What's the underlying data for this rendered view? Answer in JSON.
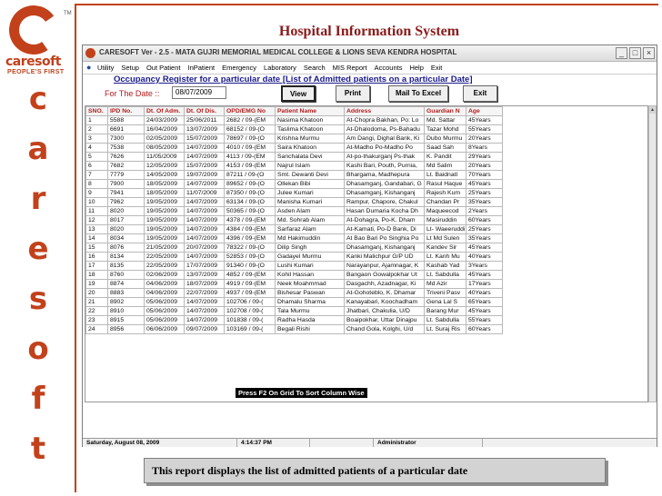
{
  "brand": {
    "logo_name": "caresoft",
    "tagline": "PEOPLE'S FIRST",
    "tm": "TM",
    "vertical_letters": [
      "c",
      "a",
      "r",
      "e",
      "s",
      "o",
      "f",
      "t"
    ],
    "accent": "#c2411b"
  },
  "slide": {
    "title": "Hospital Information System",
    "caption": "This report displays the list of admitted patients of a particular date"
  },
  "window": {
    "title": "CARESOFT  Ver - 2.5 - MATA GUJRI MEMORIAL MEDICAL COLLEGE & LIONS SEVA KENDRA HOSPITAL",
    "min": "_",
    "max": "□",
    "close": "×"
  },
  "menu": [
    "Utility",
    "Setup",
    "Out Patient",
    "InPatient",
    "Emergency",
    "Laboratory",
    "Search",
    "MIS Report",
    "Accounts",
    "Help",
    "Exit"
  ],
  "report": {
    "title": "Occupancy Register for a particular date [List of Admitted patients on a particular Date]",
    "date_label": "For The Date ::",
    "date_value": "08/07/2009",
    "buttons": {
      "view": "View",
      "print": "Print",
      "mail": "Mail To Excel",
      "exit": "Exit"
    }
  },
  "grid": {
    "headers": [
      "SNO.",
      "IPD No.",
      "Dt. Of Adm.",
      "Dt. Of Dis.",
      "OPD/EMG No",
      "Patient Name",
      "Address",
      "Guardian N",
      "Age"
    ],
    "rows": [
      [
        "1",
        "5588",
        "24/03/2009",
        "25/06/2011",
        "2682 / 09-(EM",
        "Nasima Khatoon",
        "At-Chopra Bakhan, Po: Lo",
        "Md. Sattar",
        "45Years"
      ],
      [
        "2",
        "6691",
        "16/04/2009",
        "13/07/2009",
        "68152 / 09-(O",
        "Taslima Khatoon",
        "At-Dhalodoma, Ps-Bahadu",
        "Tazar Mohd",
        "55Years"
      ],
      [
        "3",
        "7300",
        "02/05/2009",
        "15/07/2009",
        "78697 / 09-(O",
        "Krishna Murmu",
        "Am Dangi, Dighal Bank, Ki",
        "Dubo Murmu",
        "20Years"
      ],
      [
        "4",
        "7538",
        "08/05/2009",
        "14/07/2009",
        "4010 / 09-(EM",
        "Saira Khatoon",
        "At-Madho Po-Madho Po",
        "Saad Sah",
        "8Years"
      ],
      [
        "5",
        "7626",
        "11/05/2009",
        "14/07/2009",
        "4113 / 09-(EM",
        "Sanchalata Devi",
        "At-po-thakurganj Ps-thak",
        "K. Pandit",
        "29Years"
      ],
      [
        "6",
        "7682",
        "12/05/2009",
        "15/07/2009",
        "4153 / 09-(EM",
        "Najrul Islam",
        "Kashi Bari, Pouth, Purnia,",
        "Md Salim",
        "20Years"
      ],
      [
        "7",
        "7779",
        "14/05/2009",
        "19/07/2009",
        "87211 / 09-(O",
        "Smt. Dewanti Devi",
        "Bhargama, Madhepura",
        "Lt. Baidnatl",
        "70Years"
      ],
      [
        "8",
        "7900",
        "18/05/2009",
        "14/07/2009",
        "89652 / 09-(O",
        "Ollekan Bibi",
        "Dhasamganj, Gandabari, G",
        "Rasul Haque",
        "45Years"
      ],
      [
        "9",
        "7941",
        "18/05/2009",
        "11/07/2009",
        "87350 / 09-(O",
        "Julee Kumari",
        "Dhasamganj, Kishanganj",
        "Rajesh Kum",
        "25Years"
      ],
      [
        "10",
        "7962",
        "19/05/2009",
        "14/07/2009",
        "63134 / 09-(O",
        "Manisha Kumari",
        "Rampur, Chapore, Chakul",
        "Chandan Pr",
        "35Years"
      ],
      [
        "11",
        "8020",
        "19/05/2009",
        "14/07/2009",
        "50365 / 09-(O",
        "Asden Alam",
        "Hasan Dumaria Kocha Dh",
        "Maqueecod",
        "2Years"
      ],
      [
        "12",
        "8017",
        "19/05/2009",
        "14/07/2009",
        "4378 / 09-(EM",
        "Md. Sohrab Alam",
        "At-Dohagra, Po-K. Dham",
        "Masiruddin",
        "60Years"
      ],
      [
        "13",
        "8020",
        "19/05/2009",
        "14/07/2009",
        "4384 / 09-(EM",
        "Sarfaraz Alam",
        "At-Kamati, Po-D Bank, Di",
        "Lt- Waeeruddi",
        "25Years"
      ],
      [
        "14",
        "8034",
        "19/05/2009",
        "14/07/2009",
        "4396 / 09-(EM",
        "Md Hakimuddin",
        "At Bao Bari Po Singhia Po",
        "Lt Md Sulen",
        "35Years"
      ],
      [
        "15",
        "8076",
        "21/05/2009",
        "20/07/2009",
        "78322 / 09-(O",
        "Dilip Singh",
        "Dhasamganj, Kishanganj",
        "Kandev Sir",
        "45Years"
      ],
      [
        "16",
        "8134",
        "22/05/2009",
        "14/07/2009",
        "52853 / 09-(O",
        "Gadayel Murmu",
        "Kanki Malichpur G/P UD",
        "Lt. Kanh Mu",
        "40Years"
      ],
      [
        "17",
        "8135",
        "22/05/2009",
        "17/07/2009",
        "91340 / 09-(O",
        "Lushi Kumari",
        "Narayanpur, Ajamnagar, K",
        "Kashab Yad",
        "3Years"
      ],
      [
        "18",
        "8760",
        "02/06/2009",
        "13/07/2009",
        "4852 / 09-(EM",
        "Kohil Hassan",
        "Bangaon Gowalpokhar Ut",
        "Lt. Sabdulla",
        "45Years"
      ],
      [
        "19",
        "8874",
        "04/06/2009",
        "18/07/2009",
        "4919 / 09-(EM",
        "Neek Moahmmad",
        "Dasgachh, Azadnagar, Ki",
        "Md Azir",
        "17Years"
      ],
      [
        "20",
        "8883",
        "04/06/2009",
        "22/07/2009",
        "4937 / 09-(EM",
        "Bishesar Paswan",
        "At-Gohoteblo, K. Dhamar",
        "Triveni Pasv",
        "40Years"
      ],
      [
        "21",
        "8902",
        "05/06/2009",
        "14/07/2009",
        "102706 / 09-(",
        "Dhamalu Sharma",
        "Kanayabari, Koochadham",
        "Gena Lal S",
        "65Years"
      ],
      [
        "22",
        "8910",
        "05/06/2009",
        "14/07/2009",
        "102708 / 09-(",
        "Tala Murmu",
        "Jhatbari, Chakulia, U/D",
        "Barang Mur",
        "45Years"
      ],
      [
        "23",
        "8915",
        "05/06/2009",
        "14/07/2009",
        "101838 / 09-(",
        "Radha Hasda",
        "Boaipokhar, Uttar Dinajpu",
        "Lt. Sabdulla",
        "55Years"
      ],
      [
        "24",
        "8956",
        "06/06/2009",
        "09/07/2009",
        "103169 / 09-(",
        "Begali Rishi",
        "Chand Gola, Kolghi, U/d",
        "Lt. Suraj Ris",
        "60Years"
      ]
    ],
    "hint": "Press F2  On Grid To Sort  Column  Wise"
  },
  "status": {
    "date": "Saturday, August 08, 2009",
    "time": "4:14:37 PM",
    "user": "Administrator"
  }
}
